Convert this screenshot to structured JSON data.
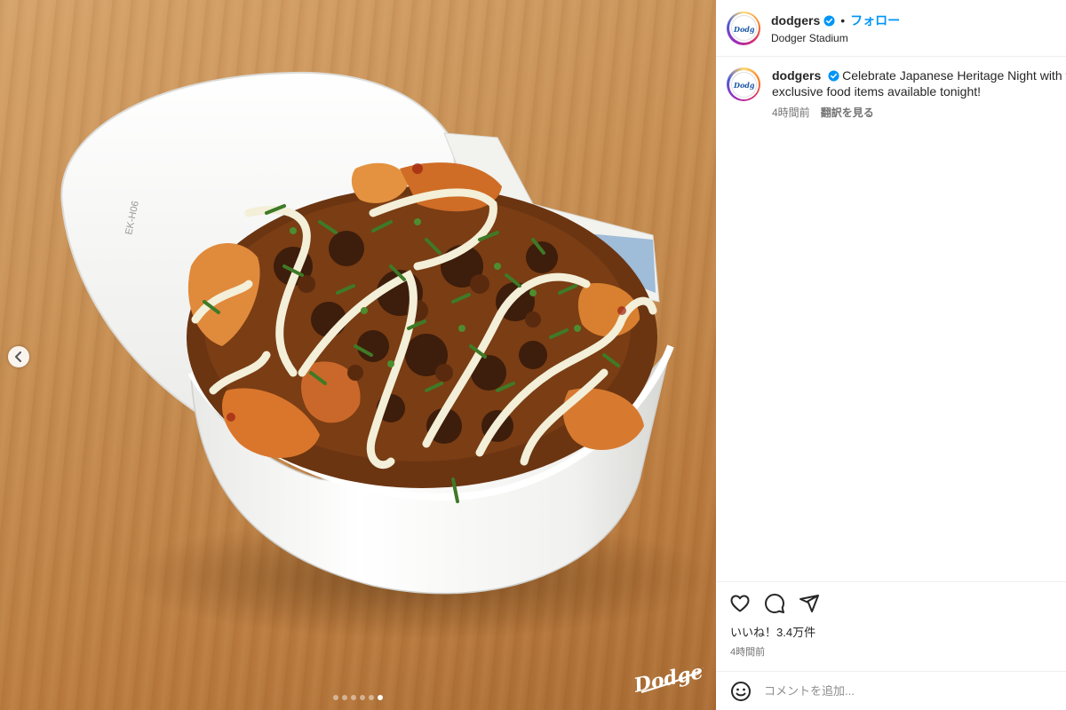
{
  "media": {
    "image_alt": "",
    "watermark_text": "Dodgers",
    "slides_total": 6,
    "slide_active": 6,
    "bowl_label": "EK-H06"
  },
  "post": {
    "username": "dodgers",
    "separator": "•",
    "follow_label": "フォロー",
    "location": "Dodger Stadium",
    "avatar_text": "Dodgers"
  },
  "caption": {
    "username": "dodgers",
    "line1": "Celebrate Japanese Heritage Night with th",
    "line2": "exclusive food items available tonight!",
    "time": "4時間前",
    "translate_label": "翻訳を見る"
  },
  "engagement": {
    "likes": "いいね！3.4万件",
    "time": "4時間前",
    "comment_placeholder": "コメントを追加..."
  },
  "icons": {
    "like": "heart-icon",
    "comment": "comment-icon",
    "share": "share-icon",
    "emoji": "emoji-icon",
    "prev": "chevron-left-icon",
    "verified": "verified-badge-icon"
  },
  "colors": {
    "follow": "#0095f6",
    "verified": "#0095f6",
    "muted": "#737373"
  }
}
